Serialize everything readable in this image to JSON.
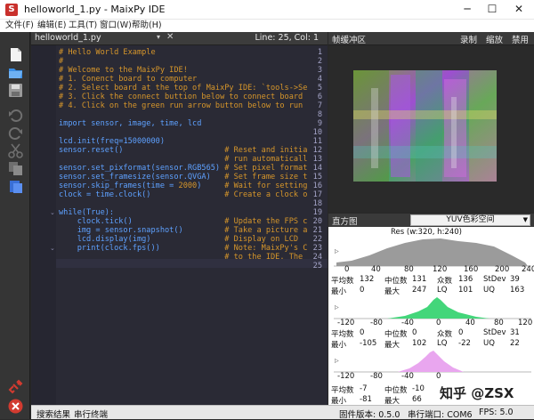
{
  "window": {
    "title": "helloworld_1.py - MaixPy IDE",
    "icon_letter": "S",
    "minimize": "─",
    "maximize": "☐",
    "close": "✕"
  },
  "menu": [
    {
      "label": "文件(F)"
    },
    {
      "label": "编辑(E)"
    },
    {
      "label": "工具(T)"
    },
    {
      "label": "窗口(W)"
    },
    {
      "label": "帮助(H)"
    }
  ],
  "toolbar_icons": [
    "new-file-icon",
    "open-folder-icon",
    "save-icon",
    "undo-icon",
    "redo-icon",
    "cut-icon",
    "copy-icon",
    "paste-icon",
    "connect-icon",
    "run-icon"
  ],
  "editor": {
    "tab_name": "helloworld_1.py",
    "tab_arrow": "▾",
    "tab_close": "✕",
    "position": "Line: 25, Col: 1",
    "lines": [
      {
        "n": "1",
        "segs": [
          {
            "t": "# Hello World Example",
            "c": "c-comment"
          }
        ]
      },
      {
        "n": "2",
        "segs": [
          {
            "t": "#",
            "c": "c-comment"
          }
        ]
      },
      {
        "n": "3",
        "segs": [
          {
            "t": "# Welcome to the MaixPy IDE!",
            "c": "c-comment"
          }
        ]
      },
      {
        "n": "4",
        "segs": [
          {
            "t": "# 1. Conenct board to computer",
            "c": "c-comment"
          }
        ]
      },
      {
        "n": "5",
        "segs": [
          {
            "t": "# 2. Select board at the top of MaixPy IDE: `tools->Se",
            "c": "c-comment"
          }
        ]
      },
      {
        "n": "6",
        "segs": [
          {
            "t": "# 3. Click the connect buttion below to connect board",
            "c": "c-comment"
          }
        ]
      },
      {
        "n": "7",
        "segs": [
          {
            "t": "# 4. Click on the green run arrow button below to run",
            "c": "c-comment"
          }
        ]
      },
      {
        "n": "8",
        "segs": []
      },
      {
        "n": "9",
        "segs": [
          {
            "t": "import",
            "c": "c-kw"
          },
          {
            "t": " sensor, image, time, lcd",
            "c": "c-kw"
          }
        ]
      },
      {
        "n": "10",
        "segs": []
      },
      {
        "n": "11",
        "segs": [
          {
            "t": "lcd.init(freq=",
            "c": "c-kw"
          },
          {
            "t": "15000000",
            "c": "c-kw"
          },
          {
            "t": ")",
            "c": "c-kw"
          }
        ]
      },
      {
        "n": "12",
        "segs": [
          {
            "t": "sensor.reset()                      ",
            "c": "c-kw"
          },
          {
            "t": "# Reset and initia",
            "c": "c-comment"
          }
        ]
      },
      {
        "n": "13",
        "segs": [
          {
            "t": "                                    ",
            "c": "c-kw"
          },
          {
            "t": "# run automaticall",
            "c": "c-comment"
          }
        ]
      },
      {
        "n": "14",
        "segs": [
          {
            "t": "sensor.set_pixformat(sensor.RGB565) ",
            "c": "c-kw"
          },
          {
            "t": "# Set pixel format",
            "c": "c-comment"
          }
        ]
      },
      {
        "n": "15",
        "segs": [
          {
            "t": "sensor.set_framesize(sensor.QVGA)   ",
            "c": "c-kw"
          },
          {
            "t": "# Set frame size t",
            "c": "c-comment"
          }
        ]
      },
      {
        "n": "16",
        "segs": [
          {
            "t": "sensor.skip_frames(time = ",
            "c": "c-kw"
          },
          {
            "t": "2000",
            "c": "c-num"
          },
          {
            "t": ")     ",
            "c": "c-kw"
          },
          {
            "t": "# Wait for setting",
            "c": "c-comment"
          }
        ]
      },
      {
        "n": "17",
        "segs": [
          {
            "t": "clock = time.clock()                ",
            "c": "c-kw"
          },
          {
            "t": "# Create a clock o",
            "c": "c-comment"
          }
        ]
      },
      {
        "n": "18",
        "segs": []
      },
      {
        "n": "19",
        "segs": [
          {
            "t": "while",
            "c": "c-kw"
          },
          {
            "t": "(True):",
            "c": "c-kw"
          }
        ],
        "fold": true
      },
      {
        "n": "20",
        "segs": [
          {
            "t": "    clock.tick()                    ",
            "c": "c-kw"
          },
          {
            "t": "# Update the FPS c",
            "c": "c-comment"
          }
        ]
      },
      {
        "n": "21",
        "segs": [
          {
            "t": "    img = sensor.snapshot()         ",
            "c": "c-kw"
          },
          {
            "t": "# Take a picture a",
            "c": "c-comment"
          }
        ]
      },
      {
        "n": "22",
        "segs": [
          {
            "t": "    lcd.display(img)                ",
            "c": "c-kw"
          },
          {
            "t": "# Display on LCD",
            "c": "c-comment"
          }
        ]
      },
      {
        "n": "23",
        "segs": [
          {
            "t": "    print(clock.fps())              ",
            "c": "c-kw"
          },
          {
            "t": "# Note: MaixPy's C",
            "c": "c-comment"
          }
        ],
        "fold": true
      },
      {
        "n": "24",
        "segs": [
          {
            "t": "                                    ",
            "c": "c-kw"
          },
          {
            "t": "# to the IDE. The ",
            "c": "c-comment"
          }
        ]
      },
      {
        "n": "25",
        "segs": []
      }
    ]
  },
  "frame_buffer": {
    "title": "帧缓冲区",
    "record": "录制",
    "zoom": "缩放",
    "disable": "禁用"
  },
  "histogram": {
    "title": "直方图",
    "color_space": "YUV色彩空间",
    "res_label": "Res (w:320, h:240)",
    "gray_ticks": [
      "0",
      "40",
      "80",
      "120",
      "160",
      "200",
      "240"
    ],
    "uv_ticks": [
      "-120",
      "-80",
      "-40",
      "0",
      "40",
      "80",
      "120"
    ],
    "stats_y": {
      "mean_label": "平均数",
      "mean": "132",
      "median_label": "中位数",
      "median": "131",
      "mode_label": "众数",
      "mode": "136",
      "stdev_label": "StDev",
      "stdev": "39",
      "min_label": "最小",
      "min": "0",
      "max_label": "最大",
      "max": "247",
      "lq_label": "LQ",
      "lq": "101",
      "uq_label": "UQ",
      "uq": "163"
    },
    "stats_u": {
      "mean_label": "平均数",
      "mean": "0",
      "median_label": "中位数",
      "median": "0",
      "mode_label": "众数",
      "mode": "0",
      "stdev_label": "StDev",
      "stdev": "31",
      "min_label": "最小",
      "min": "-105",
      "max_label": "最大",
      "max": "102",
      "lq_label": "LQ",
      "lq": "-22",
      "uq_label": "UQ",
      "uq": "22"
    },
    "stats_v": {
      "mean_label": "平均数",
      "mean": "-7",
      "median_label": "中位数",
      "median": "-10",
      "min_label": "最小",
      "min": "-81",
      "max_label": "最大",
      "max": "66"
    },
    "colors": {
      "gray": "#9b9b9b",
      "u": "#43d67a",
      "v": "#e9a6ef"
    }
  },
  "status": {
    "search": "搜索结果",
    "terminal": "串行终端",
    "firmware": "固件版本: 0.5.0",
    "serial": "串行端口: COM6",
    "fps": "FPS:   5.0"
  },
  "watermark": "知乎 @ZSX"
}
